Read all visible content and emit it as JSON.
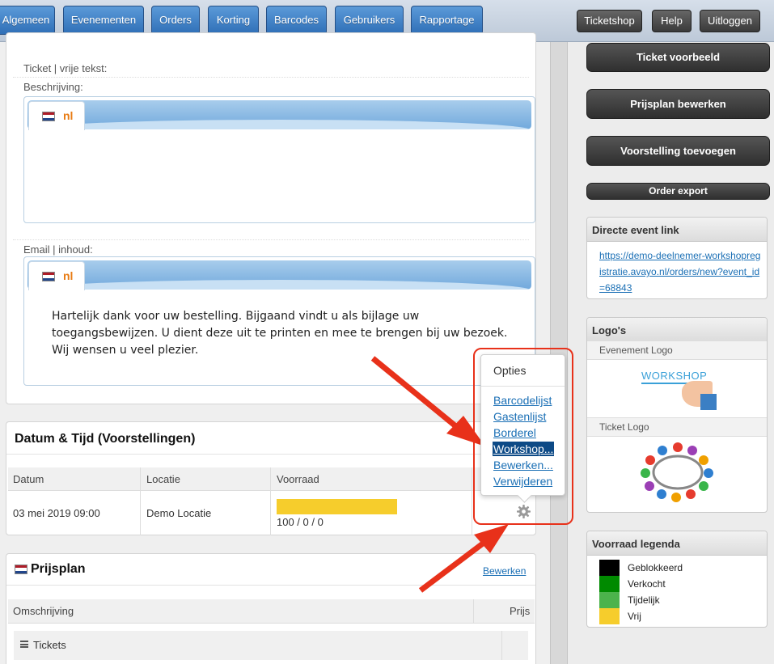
{
  "nav": {
    "left": [
      "Algemeen",
      "Evenementen",
      "Orders",
      "Korting",
      "Barcodes",
      "Gebruikers",
      "Rapportage"
    ],
    "right": [
      "Ticketshop",
      "Help",
      "Uitloggen"
    ]
  },
  "ticket_section": {
    "ticket_label": "Ticket | vrije tekst:",
    "description_label": "Beschrijving:",
    "email_label": "Email | inhoud:",
    "lang_tab": "nl",
    "email_text": "Hartelijk dank voor uw bestelling. Bijgaand vindt u als bijlage uw toegangsbewijzen. U dient deze uit te printen en mee te brengen bij uw bezoek. Wij wensen u veel plezier."
  },
  "shows": {
    "title": "Datum & Tijd (Voorstellingen)",
    "headers": [
      "Datum",
      "Locatie",
      "Voorraad"
    ],
    "rows": [
      {
        "date": "03 mei 2019 09:00",
        "location": "Demo Locatie",
        "stock_text": "100 / 0 / 0",
        "stock_free_fraction": 1.0
      }
    ]
  },
  "options_popup": {
    "title": "Opties",
    "items": [
      "Barcodelijst",
      "Gastenlijst",
      "Borderel",
      "Workshop...",
      "Bewerken...",
      "Verwijderen"
    ],
    "selected_index": 3
  },
  "pricing": {
    "title": "Prijsplan",
    "edit_link": "Bewerken",
    "headers": [
      "Omschrijving",
      "Prijs"
    ],
    "rows": [
      "Tickets"
    ]
  },
  "sidebar": {
    "buttons": [
      "Ticket voorbeeld",
      "Prijsplan bewerken",
      "Voorstelling toevoegen",
      "Order export"
    ],
    "event_link": {
      "title": "Directe event link",
      "url": "https://demo-deelnemer-workshopregistratie.avayo.nl/orders/new?event_id=68843"
    },
    "logos": {
      "title": "Logo's",
      "event_logo_label": "Evenement Logo",
      "event_logo_text": "WORKSHOP",
      "ticket_logo_label": "Ticket Logo"
    },
    "legend": {
      "title": "Voorraad legenda",
      "items": [
        {
          "label": "Geblokkeerd",
          "color": "#000000"
        },
        {
          "label": "Verkocht",
          "color": "#008a00"
        },
        {
          "label": "Tijdelijk",
          "color": "#4cb34c"
        },
        {
          "label": "Vrij",
          "color": "#f6cd2c"
        }
      ]
    }
  },
  "colors": {
    "accent": "#2f6fb7",
    "stock_bar": "#f6cd2c",
    "highlight_red": "#e8311a"
  }
}
